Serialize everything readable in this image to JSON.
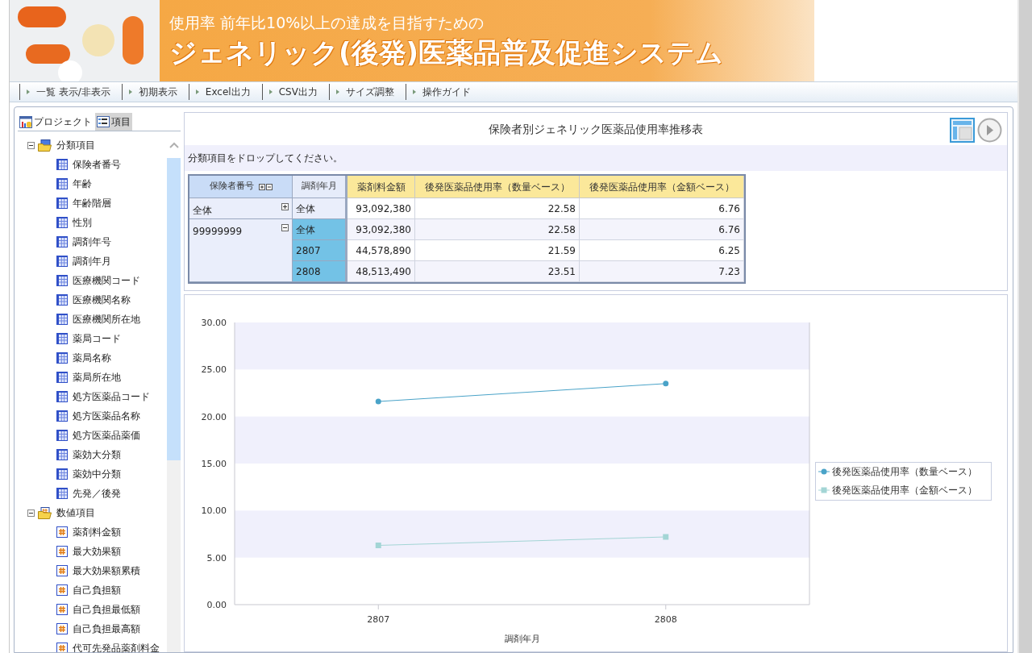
{
  "banner": {
    "subtitle": "使用率 前年比10%以上の達成を目指すための",
    "title": "ジェネリック(後発)医薬品普及促進システム"
  },
  "toolbar": [
    "一覧 表示/非表示",
    "初期表示",
    "Excel出力",
    "CSV出力",
    "サイズ調整",
    "操作ガイド"
  ],
  "left_panel": {
    "tabs": [
      {
        "label": "プロジェクト",
        "selected": false
      },
      {
        "label": "項目",
        "selected": true
      }
    ],
    "tree": [
      {
        "label": "分類項目",
        "kind": "category",
        "expanded": true,
        "children": [
          {
            "label": "保険者番号",
            "kind": "dimension"
          },
          {
            "label": "年齢",
            "kind": "dimension"
          },
          {
            "label": "年齢階層",
            "kind": "dimension"
          },
          {
            "label": "性別",
            "kind": "dimension"
          },
          {
            "label": "調剤年号",
            "kind": "dimension"
          },
          {
            "label": "調剤年月",
            "kind": "dimension"
          },
          {
            "label": "医療機関コード",
            "kind": "dimension"
          },
          {
            "label": "医療機関名称",
            "kind": "dimension"
          },
          {
            "label": "医療機関所在地",
            "kind": "dimension"
          },
          {
            "label": "薬局コード",
            "kind": "dimension"
          },
          {
            "label": "薬局名称",
            "kind": "dimension"
          },
          {
            "label": "薬局所在地",
            "kind": "dimension"
          },
          {
            "label": "処方医薬品コード",
            "kind": "dimension"
          },
          {
            "label": "処方医薬品名称",
            "kind": "dimension"
          },
          {
            "label": "処方医薬品薬価",
            "kind": "dimension"
          },
          {
            "label": "薬効大分類",
            "kind": "dimension"
          },
          {
            "label": "薬効中分類",
            "kind": "dimension"
          },
          {
            "label": "先発／後発",
            "kind": "dimension"
          }
        ]
      },
      {
        "label": "数値項目",
        "kind": "measure",
        "expanded": true,
        "children": [
          {
            "label": "薬剤料金額",
            "kind": "number"
          },
          {
            "label": "最大効果額",
            "kind": "number"
          },
          {
            "label": "最大効果額累積",
            "kind": "number"
          },
          {
            "label": "自己負担額",
            "kind": "number"
          },
          {
            "label": "自己負担最低額",
            "kind": "number"
          },
          {
            "label": "自己負担最高額",
            "kind": "number"
          },
          {
            "label": "代可先発品薬剤料金",
            "kind": "number"
          }
        ]
      }
    ]
  },
  "report": {
    "title": "保険者別ジェネリック医薬品使用率推移表",
    "drop_hint": "分類項目をドロップしてください。",
    "table": {
      "row_headers": [
        "保険者番号",
        "調剤年月"
      ],
      "columns": [
        "薬剤料金額",
        "後発医薬品使用率（数量ベース）",
        "後発医薬品使用率（金額ベース）"
      ],
      "groups": [
        {
          "label": "全体",
          "expanded": false,
          "rows": [
            {
              "month": "全体",
              "highlighted": false,
              "cells": [
                "93,092,380",
                "22.58",
                "6.76"
              ]
            }
          ]
        },
        {
          "label": "99999999",
          "expanded": true,
          "rows": [
            {
              "month": "全体",
              "highlighted": true,
              "cells": [
                "93,092,380",
                "22.58",
                "6.76"
              ]
            },
            {
              "month": "2807",
              "highlighted": true,
              "cells": [
                "44,578,890",
                "21.59",
                "6.25"
              ]
            },
            {
              "month": "2808",
              "highlighted": true,
              "cells": [
                "48,513,490",
                "23.51",
                "7.23"
              ]
            }
          ]
        }
      ]
    }
  },
  "chart": {
    "chart_data": {
      "type": "line",
      "xlabel": "調剤年月",
      "categories": [
        "2807",
        "2808"
      ],
      "series": [
        {
          "name": "後発医薬品使用率（数量ベース）",
          "color": "#4aa3c8",
          "marker": "circle",
          "values": [
            21.6,
            23.5
          ]
        },
        {
          "name": "後発医薬品使用率（金額ベース）",
          "color": "#a3d5d5",
          "marker": "square",
          "values": [
            6.3,
            7.2
          ]
        }
      ],
      "legend": true,
      "ylim": [
        0,
        30
      ],
      "yticks": [
        {
          "value": 0,
          "label": "0.00"
        },
        {
          "value": 5,
          "label": "5.00"
        },
        {
          "value": 10,
          "label": "10.00"
        },
        {
          "value": 15,
          "label": "15.00"
        },
        {
          "value": 20,
          "label": "20.00"
        },
        {
          "value": 25,
          "label": "25.00"
        },
        {
          "value": 30,
          "label": "30.00"
        }
      ]
    }
  }
}
